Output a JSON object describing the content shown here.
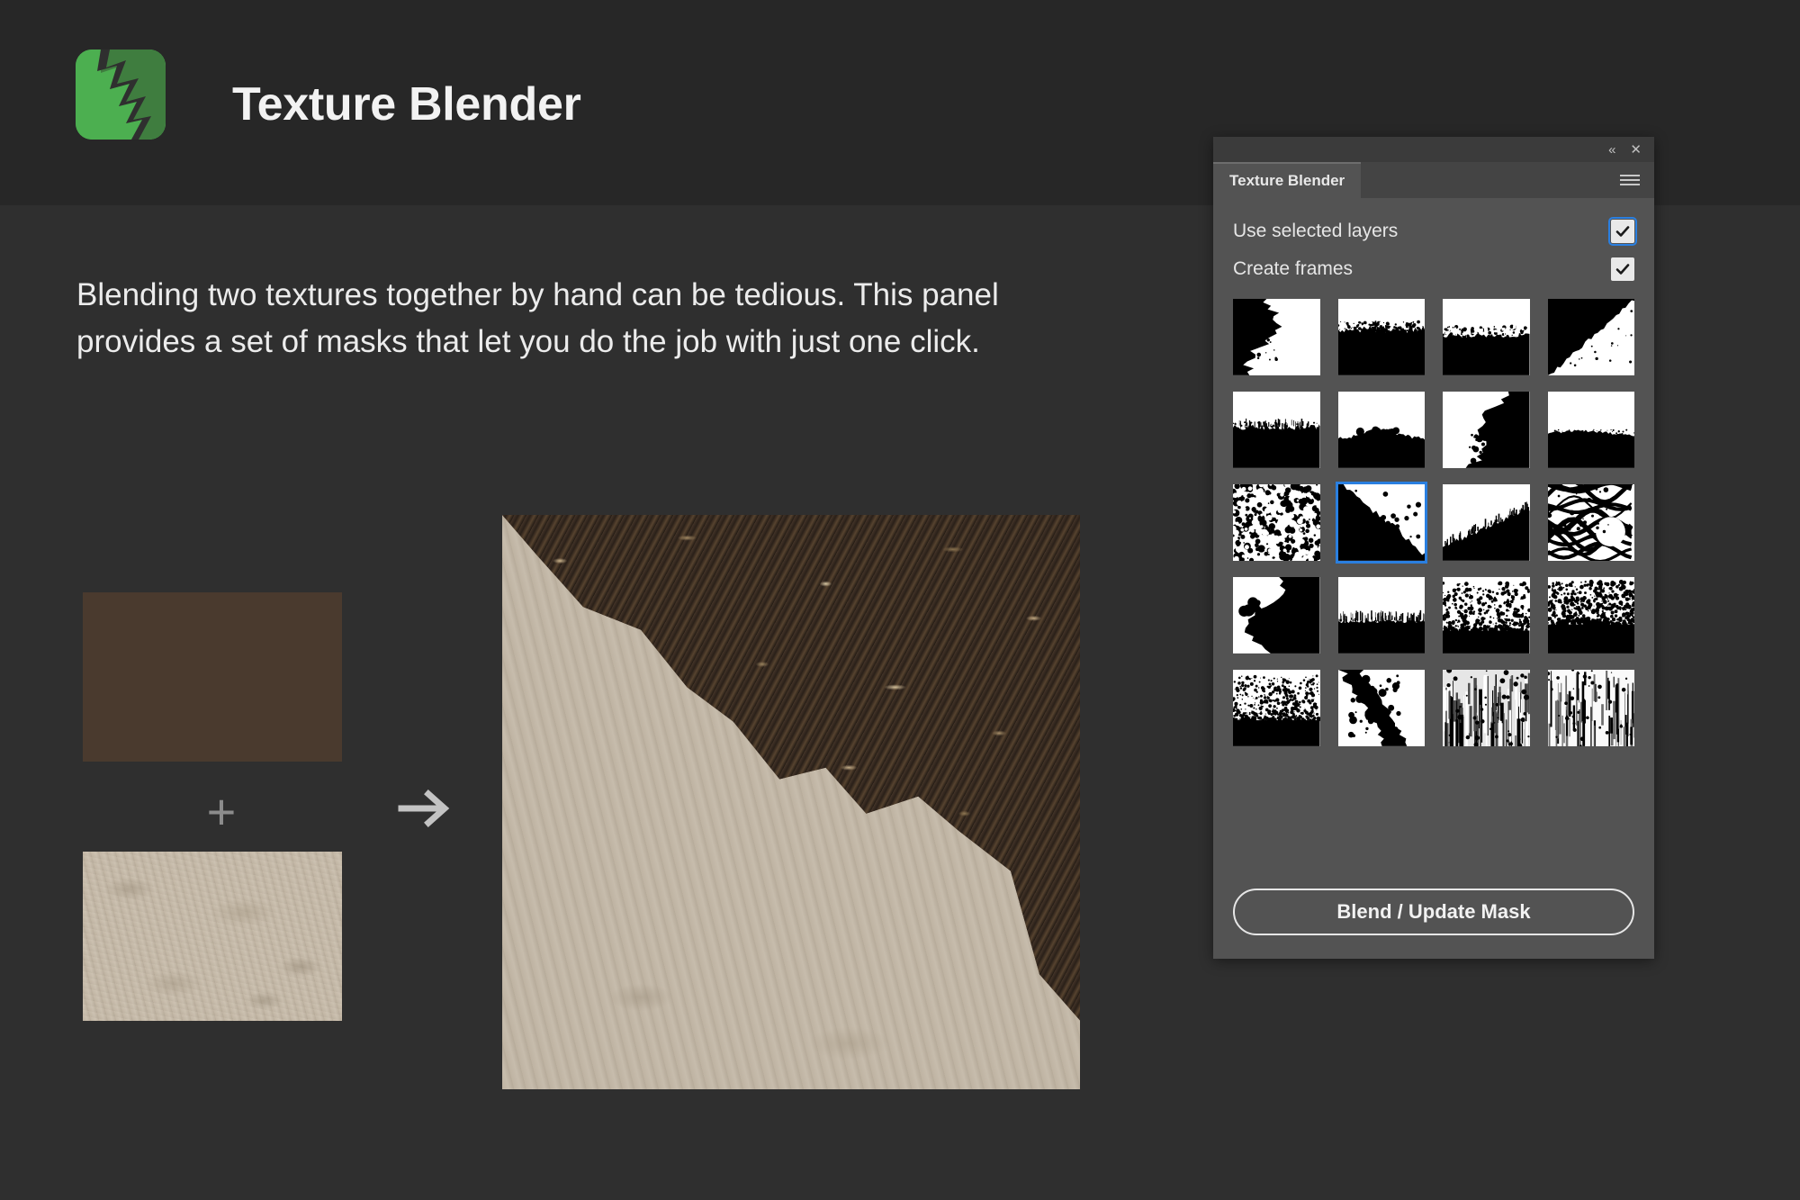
{
  "header": {
    "title": "Texture Blender",
    "logo_icon": "lightning-split-logo",
    "logo_colors": {
      "light": "#4caf50",
      "dark": "#3f7d3f",
      "bolt": "#2f2f2f"
    }
  },
  "intro": {
    "paragraph": "Blending two textures together by hand can be tedious. This panel provides a set of masks that let you do the job with just one click."
  },
  "diagram": {
    "texture_a_name": "mulch-texture-thumbnail",
    "texture_b_name": "sand-texture-thumbnail",
    "result_name": "blended-result-image",
    "plus_symbol": "+",
    "arrow_icon": "right-arrow-icon"
  },
  "panel": {
    "titlebar": {
      "collapse_icon": "«",
      "close_icon": "✕"
    },
    "tab_label": "Texture Blender",
    "menu_icon": "hamburger-menu-icon",
    "options": [
      {
        "label": "Use selected layers",
        "checked": true,
        "focused": true
      },
      {
        "label": "Create frames",
        "checked": true,
        "focused": false
      }
    ],
    "selected_mask_index": 9,
    "accent_color": "#2a7fe0",
    "masks": [
      {
        "id": "mask-01",
        "style": "cliff-edge-left"
      },
      {
        "id": "mask-02",
        "style": "speckled-horizon"
      },
      {
        "id": "mask-03",
        "style": "rubble-horizon"
      },
      {
        "id": "mask-04",
        "style": "diagonal-slope"
      },
      {
        "id": "mask-05",
        "style": "grass-horizon"
      },
      {
        "id": "mask-06",
        "style": "bush-horizon"
      },
      {
        "id": "mask-07",
        "style": "rock-right"
      },
      {
        "id": "mask-08",
        "style": "soft-horizon"
      },
      {
        "id": "mask-09",
        "style": "noise-cloud"
      },
      {
        "id": "mask-10",
        "style": "diagonal-rough"
      },
      {
        "id": "mask-11",
        "style": "rising-slope"
      },
      {
        "id": "mask-12",
        "style": "marble-swirl"
      },
      {
        "id": "mask-13",
        "style": "blob-left"
      },
      {
        "id": "mask-14",
        "style": "spiky-horizon"
      },
      {
        "id": "mask-15",
        "style": "scatter-gradient"
      },
      {
        "id": "mask-16",
        "style": "dense-scatter"
      },
      {
        "id": "mask-17",
        "style": "fine-scatter"
      },
      {
        "id": "mask-18",
        "style": "ink-diagonal"
      },
      {
        "id": "mask-19",
        "style": "vertical-streaks"
      },
      {
        "id": "mask-20",
        "style": "light-streaks"
      }
    ],
    "blend_button_label": "Blend / Update Mask"
  }
}
